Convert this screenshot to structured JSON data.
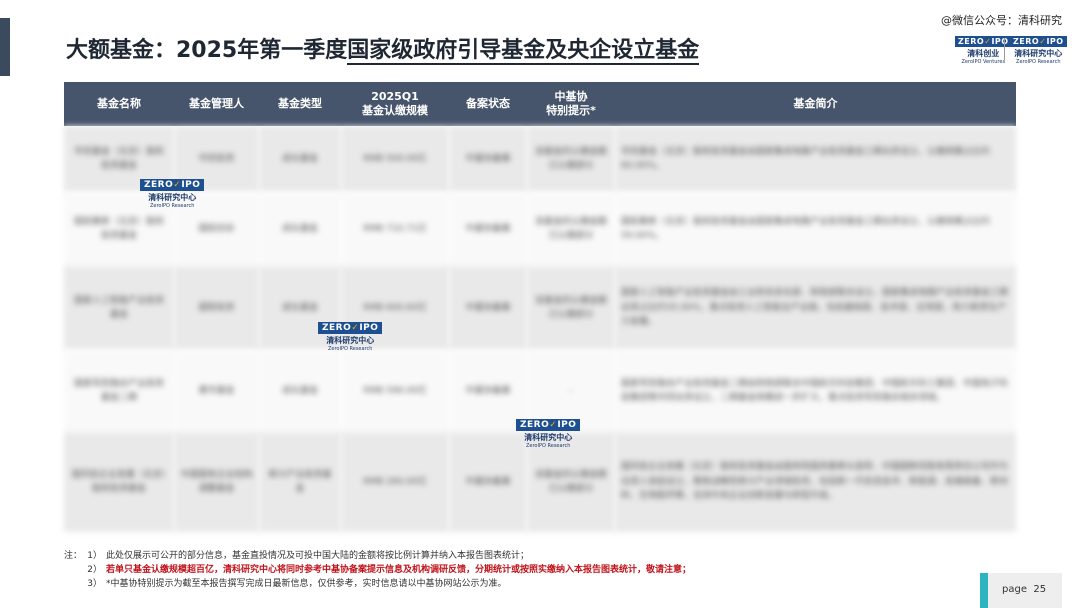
{
  "header": {
    "title_prefix": "大额基金：2025年第一季度",
    "title_underlined": "国家级政府引导基金及央企设立基金",
    "wechat_credit": "@微信公众号：清科研究"
  },
  "brand": {
    "left_mark_a": "ZERO",
    "left_mark_b": "IPO",
    "left_cn": "清科创业",
    "left_en": "ZeroIPO Ventures",
    "right_mark_a": "ZERO",
    "right_mark_b": "IPO",
    "right_cn": "清科研究中心",
    "right_en": "ZeroIPO Research"
  },
  "watermark": {
    "mark_a": "ZERO",
    "mark_b": "IPO",
    "cn": "清科研究中心",
    "en": "ZeroIPO Research"
  },
  "table": {
    "headers": [
      "基金名称",
      "基金管理人",
      "基金类型",
      "2025Q1\n基金认缴规模",
      "备案状态",
      "中基协\n特别提示*",
      "基金简介"
    ],
    "rows": [
      {
        "name": "华控基金（北京）股权投资基金",
        "manager": "华控投资",
        "type": "成长基金",
        "size": "RMB 500.00亿",
        "status": "中基协备案",
        "notice": "该基金的认缴金额已认缴部分",
        "desc": "华控基金（北京）股权投资基金由国家集成电路产业投资基金三期出资设立，认缴规模占比约60.00%。"
      },
      {
        "name": "国投集新（北京）股权投资基金",
        "manager": "国投创合",
        "type": "成长基金",
        "size": "RMB 710.71亿",
        "status": "中基协备案",
        "notice": "该基金的认缴金额已认缴部分",
        "desc": "国投集新（北京）股权投资基金由国家集成电路产业投资基金三期出资设立，认缴规模占比约59.00%。"
      },
      {
        "name": "国家人工智能产业投资基金",
        "manager": "国智投资",
        "type": "成长基金",
        "size": "RMB 600.60亿",
        "status": "中基协备案",
        "notice": "该基金的认缴金额已认缴部分",
        "desc": "国家人工智能产业投资基金由工业和信息化部、财政部联合设立，国家集成电路产业投资基金三期出资占比约35.00%，重点投资人工智能全产业链，包括基础层、技术层、应用层，助力新质生产力发展。"
      },
      {
        "name": "国家军民融合产业投资基金二期",
        "manager": "惠华基金",
        "type": "成长基金",
        "size": "RMB 596.00亿",
        "status": "中基协备案",
        "notice": "-",
        "desc": "国家军民融合产业投资基金二期由财政部联合中国航天科技集团、中国航天科工集团、中国电子科技集团等共同出资设立，二期基金规模进一步扩大，重点投资军民融合相关领域。"
      },
      {
        "name": "国风投企业发展（北京）股权投资基金",
        "manager": "中国国有企业结构调整基金",
        "type": "新兴产业投资基金",
        "size": "RMB 260.00亿",
        "status": "中基协备案",
        "notice": "该基金的认缴金额已认缴部分",
        "desc": "国风投企业发展（北京）股权投资基金由国务院国资委牵头指导、中国国新控股有限责任公司作为出资人发起设立，聚焦战略性新兴产业领域投资，包括新一代信息技术、新能源、高端装备、新材料、生物医药等，支持中央企业创新发展与转型升级。"
      }
    ]
  },
  "notes": {
    "lead": "注：",
    "items": [
      {
        "num": "1）",
        "text": "此处仅展示可公开的部分信息，基金直投情况及可投中国大陆的金额将按比例计算并纳入本报告图表统计；",
        "red": false
      },
      {
        "num": "2）",
        "text": "若单只基金认缴规模超百亿，清科研究中心将同时参考中基协备案提示信息及机构调研反馈，分期统计或按照实缴纳入本报告图表统计，敬请注意；",
        "red": true
      },
      {
        "num": "3）",
        "text": "*中基协特别提示为截至本报告撰写完成日最新信息，仅供参考，实时信息请以中基协网站公示为准。",
        "red": false
      }
    ]
  },
  "footer": {
    "page_label": "page",
    "page_number": "25"
  },
  "colors": {
    "table_header": "#46556b",
    "accent_bar": "#3c4a5e",
    "page_badge_accent": "#2cb5c0",
    "note_red": "#c0141c"
  }
}
